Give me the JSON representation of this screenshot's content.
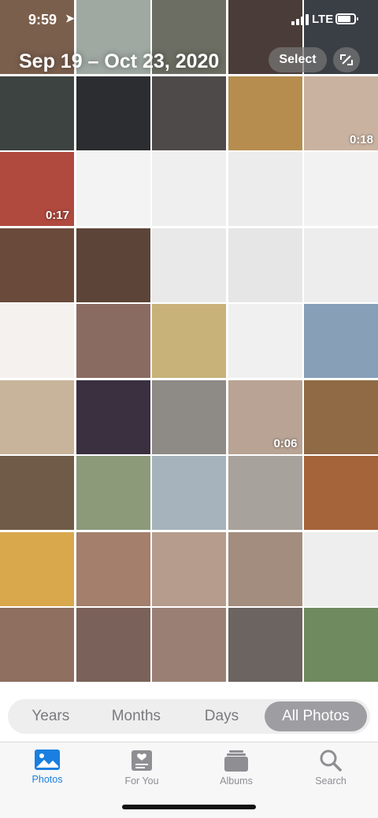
{
  "status_bar": {
    "time": "9:59",
    "network": "LTE"
  },
  "header": {
    "date_range": "Sep 19 – Oct 23, 2020",
    "select_label": "Select",
    "mode_icon": "aspect-ratio-icon"
  },
  "colors": {
    "accent": "#1a7fe0",
    "inactive": "#8e8e93",
    "segment_active_bg": "#9e9ea2"
  },
  "grid": {
    "items": [
      {
        "color": "#7b5f4d",
        "duration": ""
      },
      {
        "color": "#9fa9a2",
        "duration": ""
      },
      {
        "color": "#6c6e63",
        "duration": ""
      },
      {
        "color": "#4a3c38",
        "duration": ""
      },
      {
        "color": "#3a3e45",
        "duration": ""
      },
      {
        "color": "#3d4340",
        "duration": ""
      },
      {
        "color": "#2c2d30",
        "duration": ""
      },
      {
        "color": "#4f4a4a",
        "duration": ""
      },
      {
        "color": "#b68d4e",
        "duration": ""
      },
      {
        "color": "#c9b2a0",
        "duration": "0:18"
      },
      {
        "color": "#b04a3e",
        "duration": "0:17"
      },
      {
        "color": "#f3f3f3",
        "duration": ""
      },
      {
        "color": "#efefef",
        "duration": ""
      },
      {
        "color": "#ececec",
        "duration": ""
      },
      {
        "color": "#f2f2f2",
        "duration": ""
      },
      {
        "color": "#6a4b3b",
        "duration": ""
      },
      {
        "color": "#5c4538",
        "duration": ""
      },
      {
        "color": "#e9e9e9",
        "duration": ""
      },
      {
        "color": "#e6e6e6",
        "duration": ""
      },
      {
        "color": "#ededed",
        "duration": ""
      },
      {
        "color": "#f4f1ee",
        "duration": ""
      },
      {
        "color": "#8a6b62",
        "duration": ""
      },
      {
        "color": "#c9b27a",
        "duration": ""
      },
      {
        "color": "#f0f0f0",
        "duration": ""
      },
      {
        "color": "#87a0b8",
        "duration": ""
      },
      {
        "color": "#c8b49a",
        "duration": ""
      },
      {
        "color": "#3b3040",
        "duration": ""
      },
      {
        "color": "#8e8a86",
        "duration": ""
      },
      {
        "color": "#b8a394",
        "duration": "0:06"
      },
      {
        "color": "#8f6a45",
        "duration": ""
      },
      {
        "color": "#6f5b48",
        "duration": ""
      },
      {
        "color": "#8c9a7a",
        "duration": ""
      },
      {
        "color": "#a7b3bc",
        "duration": ""
      },
      {
        "color": "#a8a29c",
        "duration": ""
      },
      {
        "color": "#a5643a",
        "duration": ""
      },
      {
        "color": "#d9a84c",
        "duration": ""
      },
      {
        "color": "#a37f6c",
        "duration": ""
      },
      {
        "color": "#b59c8c",
        "duration": ""
      },
      {
        "color": "#a38d7e",
        "duration": ""
      },
      {
        "color": "#eeeeef",
        "duration": ""
      },
      {
        "color": "#8e6f60",
        "duration": ""
      },
      {
        "color": "#7a625a",
        "duration": ""
      },
      {
        "color": "#9a8074",
        "duration": ""
      },
      {
        "color": "#6b6460",
        "duration": ""
      },
      {
        "color": "#6f8a5e",
        "duration": ""
      }
    ]
  },
  "segments": [
    {
      "label": "Years",
      "active": false
    },
    {
      "label": "Months",
      "active": false
    },
    {
      "label": "Days",
      "active": false
    },
    {
      "label": "All Photos",
      "active": true
    }
  ],
  "tabs": [
    {
      "label": "Photos",
      "icon": "photos-icon",
      "active": true
    },
    {
      "label": "For You",
      "icon": "for-you-icon",
      "active": false
    },
    {
      "label": "Albums",
      "icon": "albums-icon",
      "active": false
    },
    {
      "label": "Search",
      "icon": "search-icon",
      "active": false
    }
  ]
}
